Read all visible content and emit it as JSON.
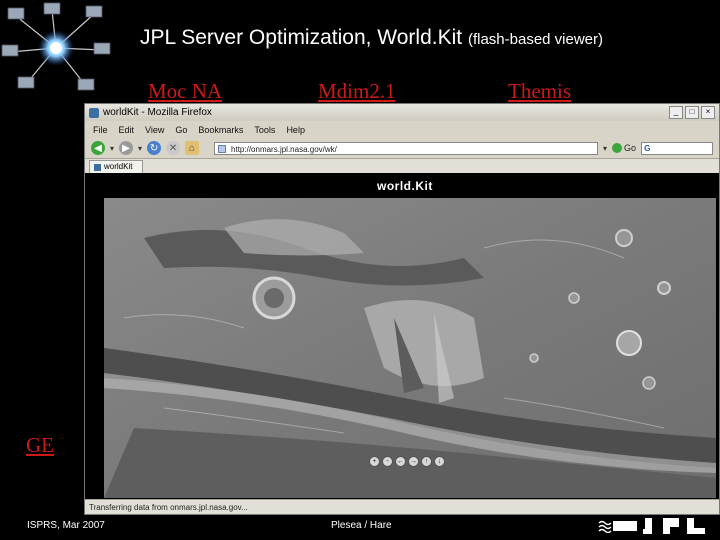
{
  "slide": {
    "title": "JPL Server Optimization, World.Kit",
    "subtitle": "(flash-based viewer)",
    "links": {
      "moc": "Moc NA",
      "mdim": "Mdim2.1",
      "themis": "Themis",
      "ge": "GE"
    },
    "footer_left": "ISPRS, Mar 2007",
    "footer_center": "Plesea / Hare"
  },
  "browser": {
    "window_title": "worldKit - Mozilla Firefox",
    "menu": [
      "File",
      "Edit",
      "View",
      "Go",
      "Bookmarks",
      "Tools",
      "Help"
    ],
    "url": "http://onmars.jpl.nasa.gov/wk/",
    "go_label": "Go",
    "tab_label": "worldKit",
    "viewer_logo": "world.Kit",
    "status": "Transferring data from onmars.jpl.nasa.gov...",
    "map_controls": [
      "+",
      "-",
      "←",
      "→",
      "↑",
      "↓"
    ]
  },
  "icons": {
    "back": "back-arrow-icon",
    "forward": "forward-arrow-icon",
    "reload": "reload-icon",
    "stop": "stop-icon",
    "home": "home-icon"
  },
  "colors": {
    "link": "#cc1a1a",
    "background": "#000000",
    "browser_chrome": "#d8d4c8"
  }
}
